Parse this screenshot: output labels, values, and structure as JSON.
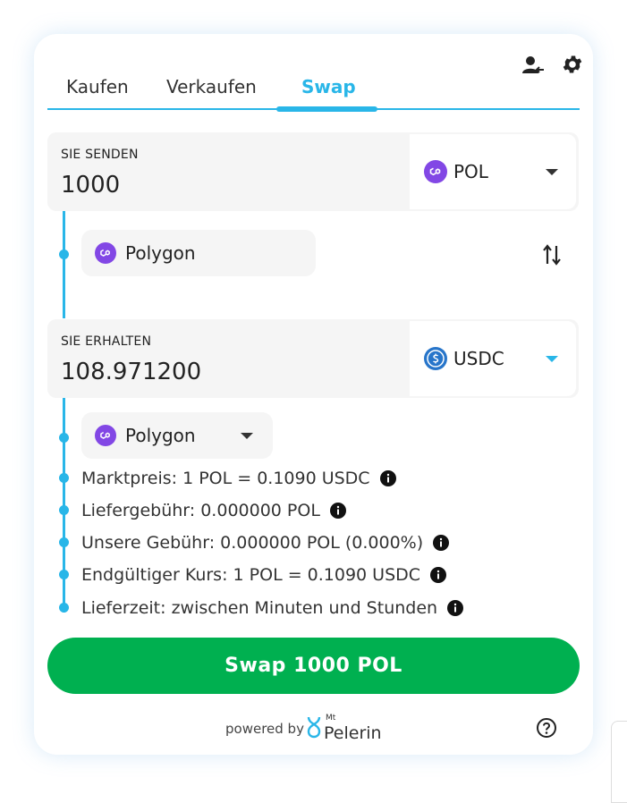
{
  "tabs": [
    {
      "label": "Kaufen",
      "active": false
    },
    {
      "label": "Verkaufen",
      "active": false
    },
    {
      "label": "Swap",
      "active": true
    }
  ],
  "header_icons": [
    "user-switch-icon",
    "gear-icon"
  ],
  "send": {
    "label": "SIE SENDEN",
    "amount": "1000",
    "currency": "POL",
    "currency_icon": "polygon-icon",
    "network": "Polygon"
  },
  "receive": {
    "label": "SIE ERHALTEN",
    "amount": "108.971200",
    "currency": "USDC",
    "currency_icon": "usdc-icon",
    "network": "Polygon"
  },
  "info_rows": [
    "Marktpreis: 1 POL = 0.1090 USDC",
    "Liefergebühr: 0.000000 POL",
    "Unsere Gebühr: 0.000000 POL (0.000%)",
    "Endgültiger Kurs: 1 POL = 0.1090 USDC",
    "Lieferzeit: zwischen Minuten und Stunden"
  ],
  "swap_button": "Swap 1000 POL",
  "footer": {
    "powered_by": "powered by",
    "brand_top": "Mt",
    "brand_name": "Pelerin"
  },
  "colors": {
    "accent": "#29b6e8",
    "button": "#00b050",
    "polygon": "#8247e5",
    "usdc": "#2775ca"
  }
}
